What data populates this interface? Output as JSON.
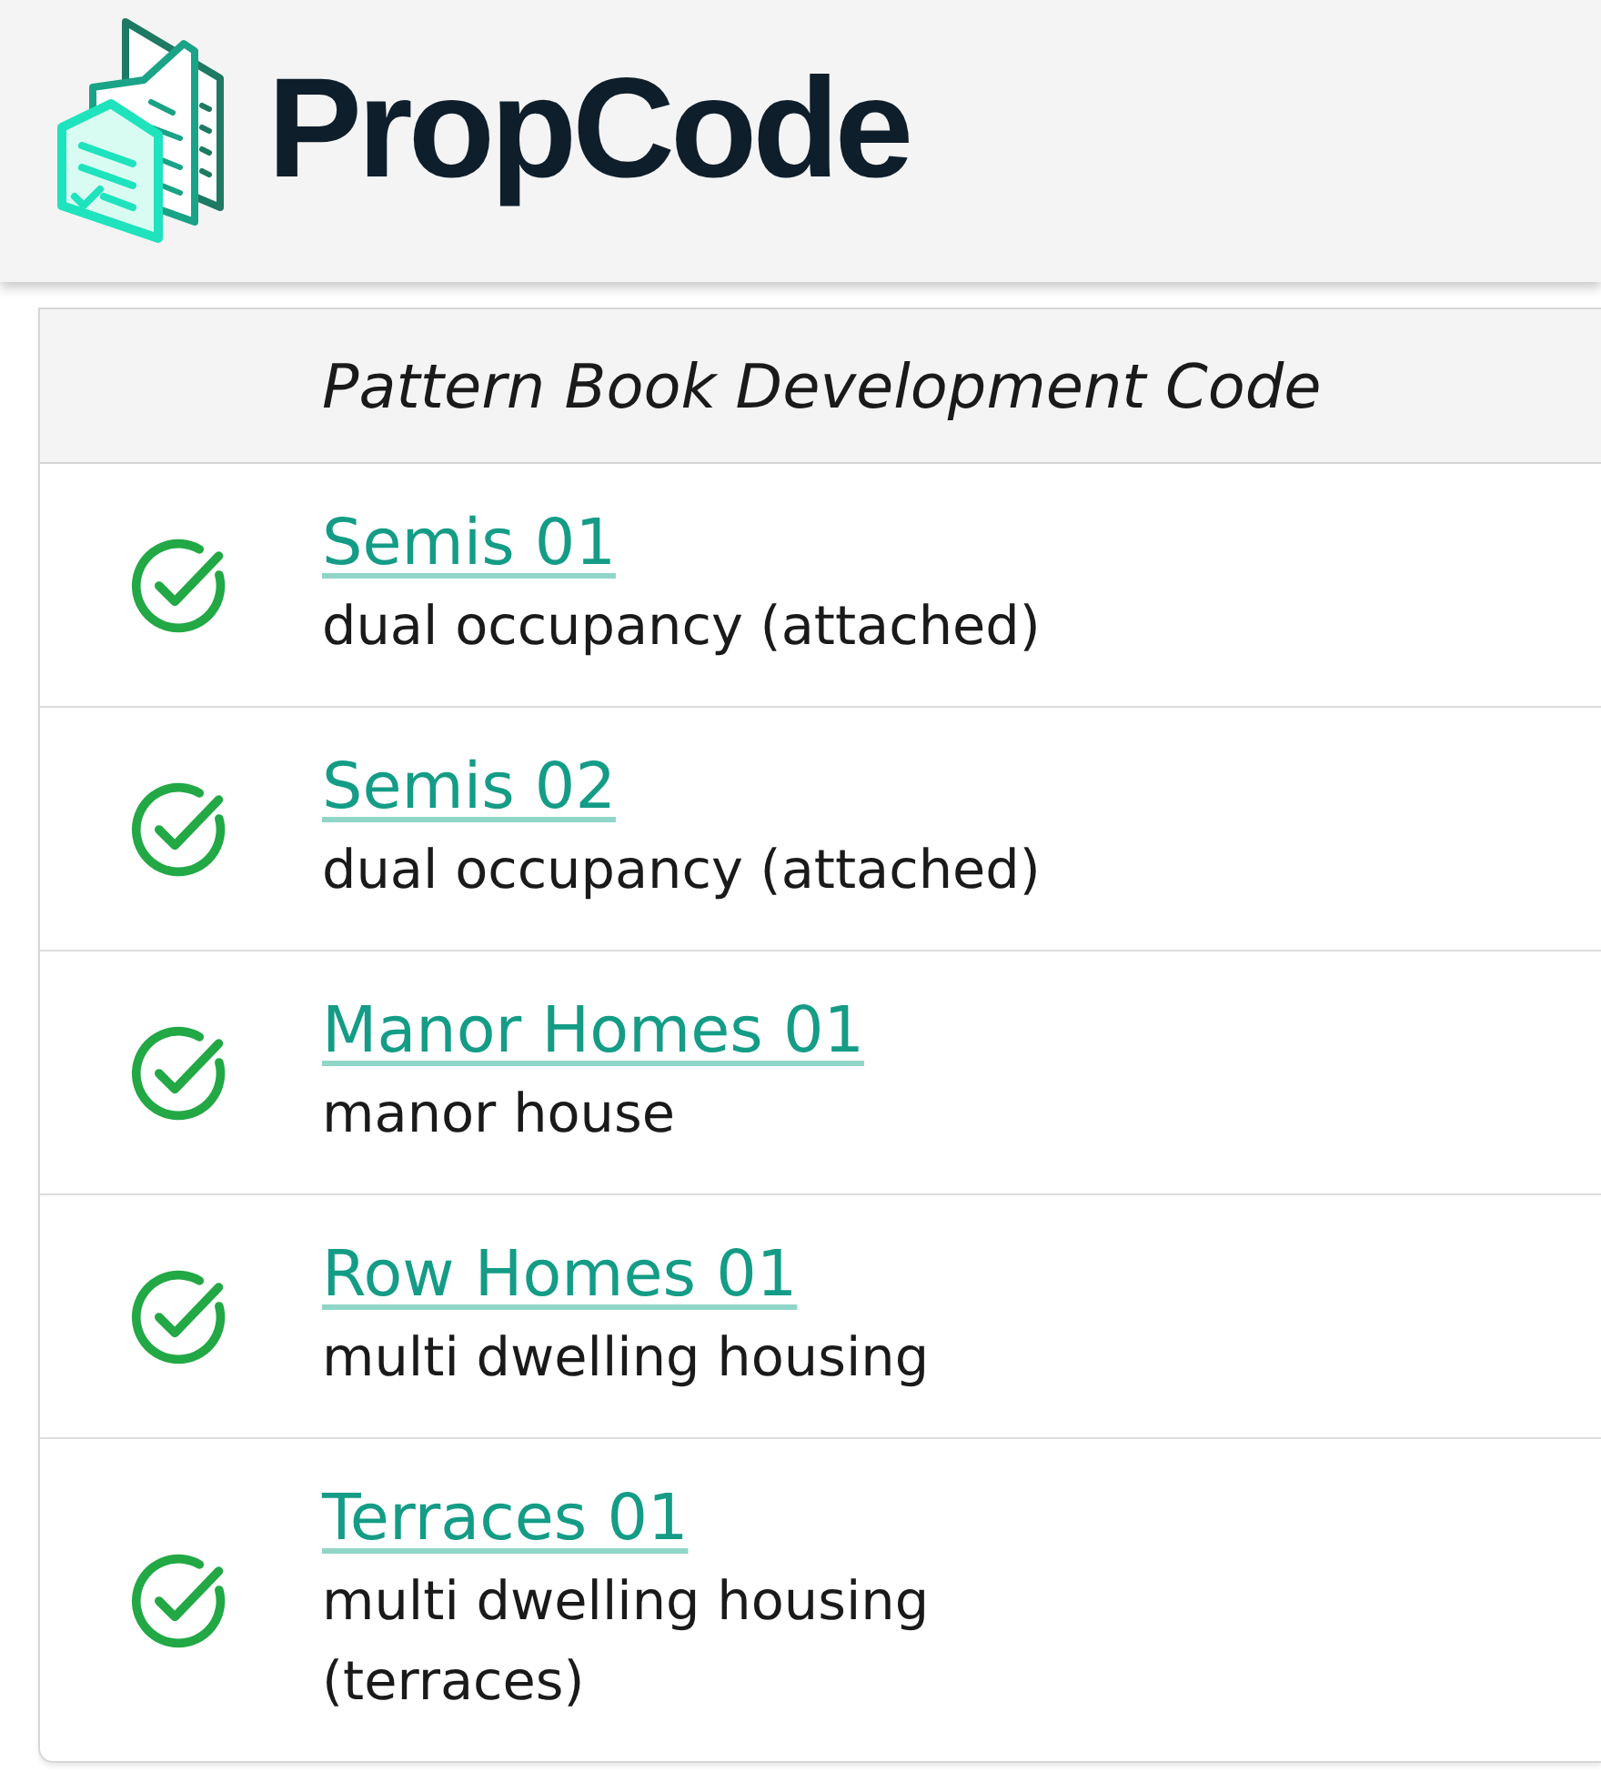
{
  "header": {
    "brand": "PropCode"
  },
  "table": {
    "heading": "Pattern Book Development Code",
    "rows": [
      {
        "title": "Semis 01",
        "description": "dual occupancy (attached)",
        "complete": true
      },
      {
        "title": "Semis 02",
        "description": "dual occupancy (attached)",
        "complete": true
      },
      {
        "title": "Manor Homes 01",
        "description": "manor house",
        "complete": true
      },
      {
        "title": "Row Homes 01",
        "description": "multi dwelling housing",
        "complete": true
      },
      {
        "title": "Terraces 01",
        "description": "multi dwelling housing (terraces)",
        "complete": true
      }
    ]
  }
}
